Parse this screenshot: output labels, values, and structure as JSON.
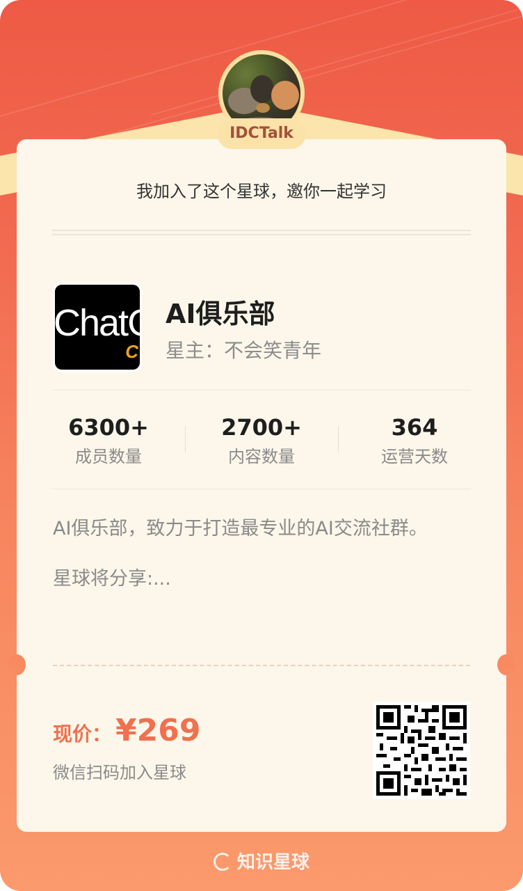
{
  "header": {
    "username": "IDCTalk",
    "invite_text": "我加入了这个星球，邀你一起学习"
  },
  "club": {
    "logo_text": "ChatG",
    "logo_sub": "C",
    "title": "AI俱乐部",
    "owner": "星主：不会笑青年"
  },
  "stats": [
    {
      "value": "6300+",
      "label": "成员数量"
    },
    {
      "value": "2700+",
      "label": "内容数量"
    },
    {
      "value": "364",
      "label": "运营天数"
    }
  ],
  "description": {
    "line1": "AI俱乐部，致力于打造最专业的AI交流社群。",
    "line2": "星球将分享:..."
  },
  "price": {
    "label": "现价：",
    "value": "¥269",
    "scan_text": "微信扫码加入星球"
  },
  "footer": {
    "brand": "知识星球"
  },
  "colors": {
    "accent": "#f0704f",
    "card_bg": "#fcf7ea",
    "ribbon": "#fbe5ac"
  }
}
